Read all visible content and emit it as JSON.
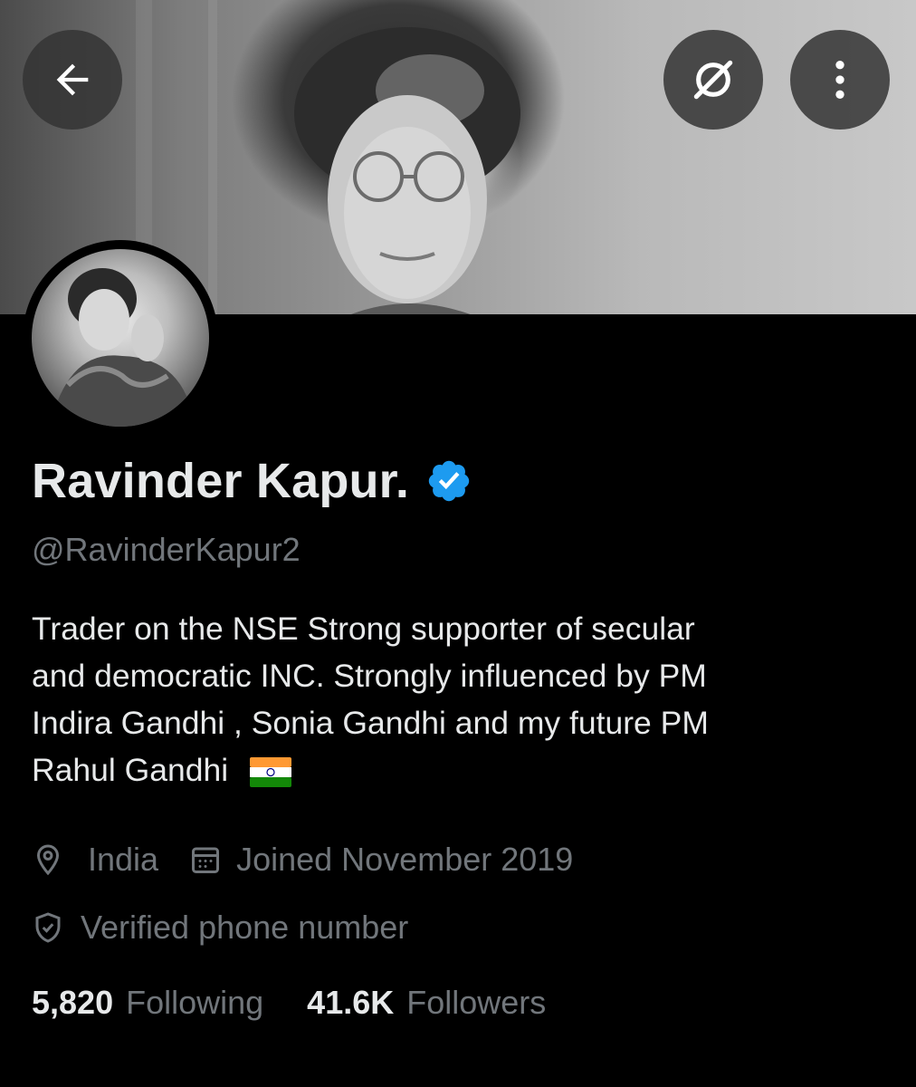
{
  "header": {
    "back_icon": "arrow-left-icon",
    "search_icon": "search-hidden-icon",
    "more_icon": "more-vertical-icon"
  },
  "profile": {
    "name": "Ravinder Kapur.",
    "verified": true,
    "verified_color": "#1d9bf0",
    "handle": "@RavinderKapur2",
    "bio_lines": [
      "Trader on the NSE  Strong supporter of secular",
      "and democratic INC. Strongly influenced by  PM",
      "Indira Gandhi , Sonia Gandhi and my future PM",
      "Rahul Gandhi"
    ],
    "bio_emoji": "india-flag",
    "location": "India",
    "joined": "Joined November 2019",
    "verified_phone": "Verified phone number"
  },
  "stats": {
    "following_count": "5,820",
    "following_label": "Following",
    "followers_count": "41.6K",
    "followers_label": "Followers"
  },
  "colors": {
    "background": "#000000",
    "primary_text": "#e7e9ea",
    "secondary_text": "#71767b",
    "accent": "#1d9bf0"
  }
}
